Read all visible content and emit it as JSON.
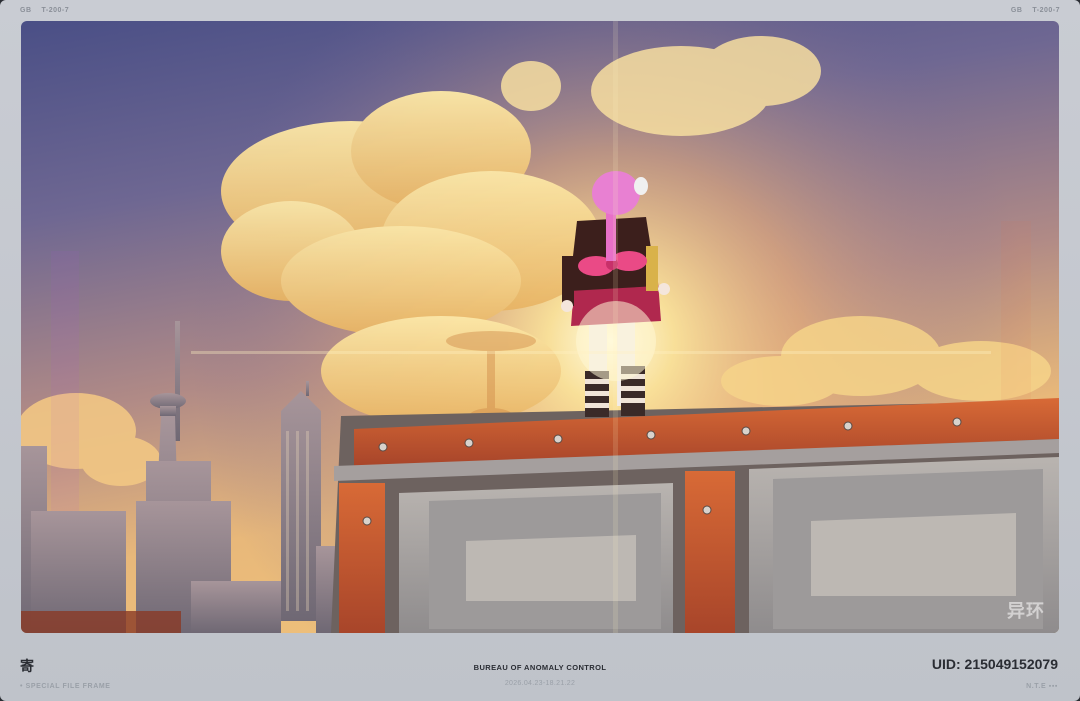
{
  "header": {
    "left_code_a": "GB",
    "left_code_b": "T-200-7",
    "right_code_a": "GB",
    "right_code_b": "T-200-7"
  },
  "photo": {
    "watermark": "异环",
    "description_icon": "photo-frame"
  },
  "footer": {
    "left_glyph": "寄",
    "left_caption": "• SPECIAL FILE FRAME",
    "center_title": "BUREAU OF ANOMALY CONTROL",
    "center_date": "2026.04.23-18.21.22",
    "uid": "UID: 215049152079",
    "right_caption": "N.T.E ▪▪▪"
  },
  "colors": {
    "frame": "#c9ccd3",
    "platform_orange": "#c2552a",
    "sky_top": "#4a4f86",
    "sun": "#fff3c4"
  }
}
